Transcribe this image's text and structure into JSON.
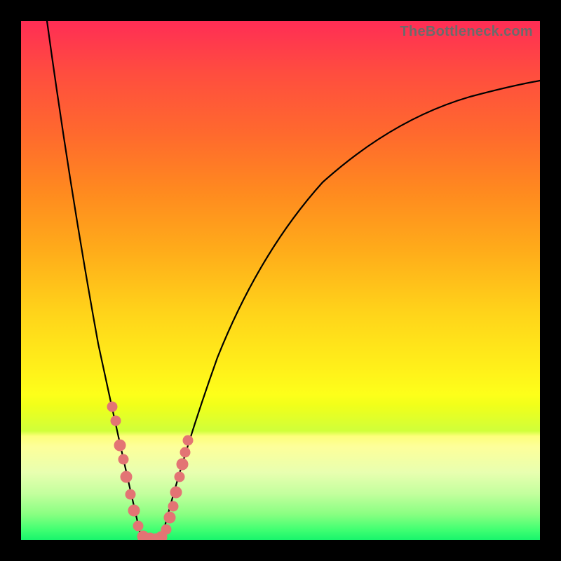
{
  "watermark": "TheBottleneck.com",
  "colors": {
    "marker": "#e37474",
    "curve": "#000000",
    "frame": "#000000"
  },
  "chart_data": {
    "type": "line",
    "title": "",
    "xlabel": "",
    "ylabel": "",
    "xlim": [
      0,
      100
    ],
    "ylim": [
      0,
      100
    ],
    "grid": false,
    "legend": false,
    "note": "Heat-map background: top (red) = high bottleneck, bottom (green) = low bottleneck. V-shaped curve dips to zero near x≈23–27 where components are balanced.",
    "series": [
      {
        "name": "bottleneck_curve_left",
        "x": [
          5,
          8,
          11,
          14,
          17,
          20,
          23
        ],
        "values": [
          100,
          84,
          66,
          47,
          30,
          14,
          0
        ]
      },
      {
        "name": "bottleneck_curve_right",
        "x": [
          27,
          30,
          35,
          40,
          45,
          50,
          55,
          60,
          65,
          70,
          75,
          80,
          85,
          90,
          95,
          100
        ],
        "values": [
          0,
          11,
          27,
          40,
          50,
          58,
          64,
          69,
          73,
          76,
          79,
          81.5,
          83.5,
          85,
          86.3,
          87.5
        ]
      },
      {
        "name": "sample_points",
        "x": [
          17.5,
          18.2,
          19.0,
          19.5,
          20.2,
          21.0,
          21.6,
          22.3,
          23.5,
          24.8,
          25.5,
          26.3,
          27.0,
          27.8,
          28.3,
          29.0,
          29.8,
          30.3,
          30.8,
          31.3
        ],
        "values": [
          26,
          23,
          18,
          16,
          12,
          9,
          6,
          3,
          0,
          0,
          0,
          1,
          2,
          4,
          6,
          9,
          12,
          14,
          16,
          18
        ]
      }
    ]
  }
}
